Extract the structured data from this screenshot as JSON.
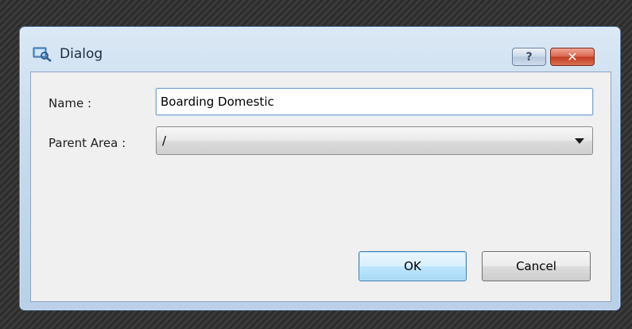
{
  "window": {
    "title": "Dialog",
    "help_glyph": "?",
    "close_glyph": "✕"
  },
  "form": {
    "name_label": "Name :",
    "name_value": "Boarding Domestic",
    "parent_label": "Parent Area :",
    "parent_value": "/"
  },
  "buttons": {
    "ok_label": "OK",
    "cancel_label": "Cancel"
  },
  "colors": {
    "titlebar": "#c7dbee",
    "close_button": "#c23b22",
    "default_button_border": "#3c7fb1"
  },
  "icons": {
    "app": "app-window-icon",
    "help": "help-icon",
    "close": "close-icon",
    "dropdown": "chevron-down-icon"
  }
}
